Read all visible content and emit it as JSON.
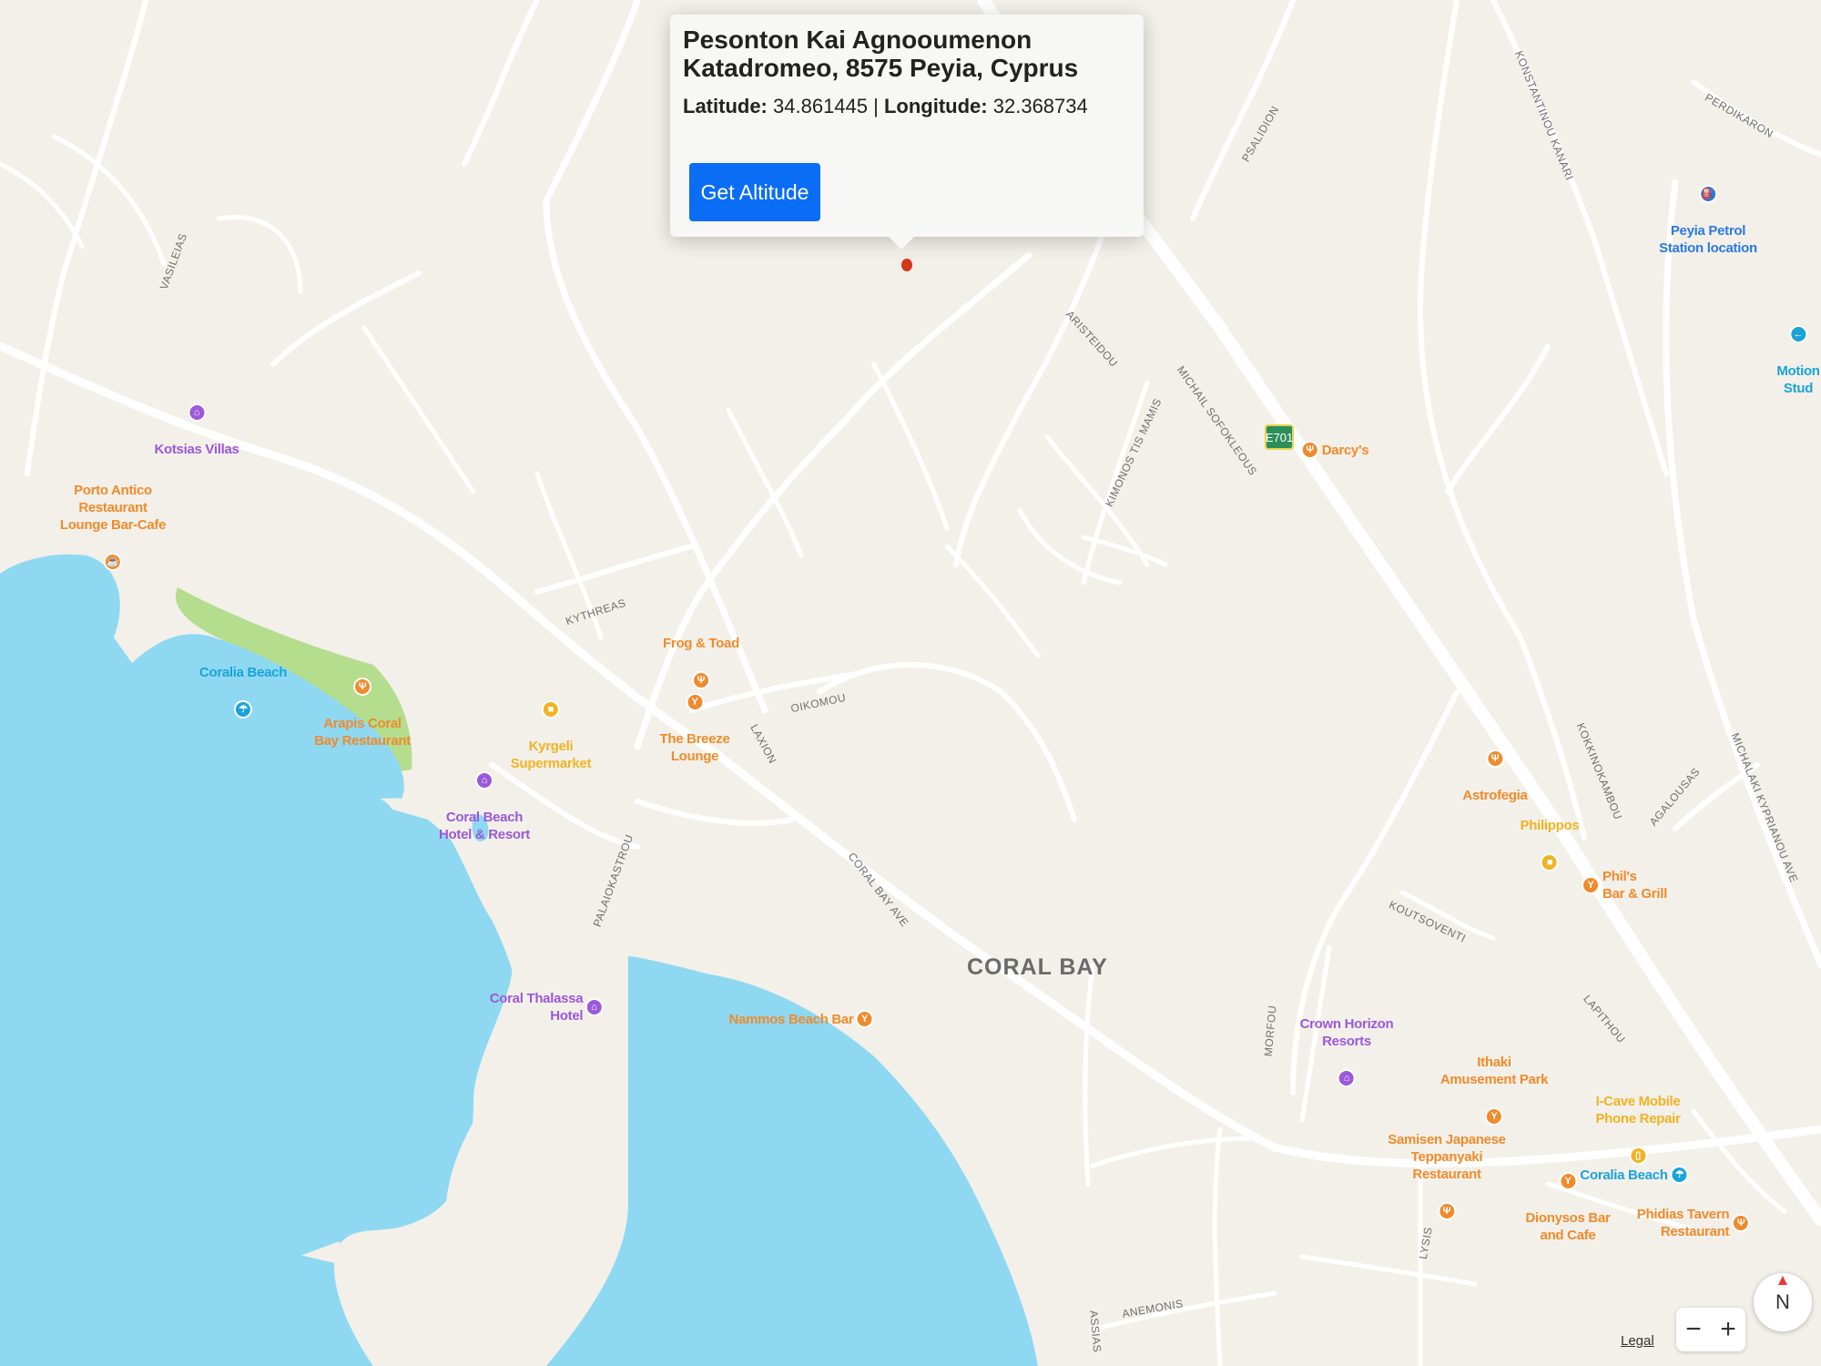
{
  "popup": {
    "title_line1": "Pesonton Kai Agnooumenon",
    "title_line2": "Katadromeo, 8575 Peyia, Cyprus",
    "lat_label": "Latitude:",
    "lat_value": "34.861445",
    "separator": "|",
    "lon_label": "Longitude:",
    "lon_value": "32.368734",
    "button_label": "Get Altitude"
  },
  "area_label": "CORAL BAY",
  "highway_shield": "E701",
  "streets": {
    "vasileias": "VASILEIAS",
    "kythreas": "KYTHREAS",
    "laxion": "LAXION",
    "oikomou": "OIKOMOU",
    "coral_bay_ave": "CORAL BAY AVE",
    "palaiokastrou": "PALAIOKASTROU",
    "psalidion": "PSALIDION",
    "aristeidou": "ARISTEIDOU",
    "michail_sofokleous": "MICHAIL SOFOKLEOUS",
    "kimonos_tis_mamis": "KIMONOS TIS MAMIS",
    "konstantinou_kanari": "KONSTANTINOU KANARI",
    "perdikarou": "PERDIKARON",
    "michalaki_kyprianou_ave": "MICHALAKI KYPRIANOU AVE",
    "agalousas": "AGALOUSAS",
    "kokkinokambou": "KOKKINOKAMBOU",
    "koutsoventi": "KOUTSOVENTI",
    "lapithou": "LAPITHOU",
    "morfou": "MORFOU",
    "lysis": "LYSIS",
    "anemonis": "ANEMONIS",
    "assias": "ASSIAS"
  },
  "pois": [
    {
      "name": "Kotsias Villas",
      "color": "#9b59d9",
      "icon": "bed-icon"
    },
    {
      "name": "Porto Antico\nRestaurant\nLounge Bar-Cafe",
      "color": "#f08b2c",
      "icon": "cafe-icon"
    },
    {
      "name": "Coralia Beach",
      "color": "#1aa3d9",
      "icon": "beach-icon"
    },
    {
      "name": "Arapis Coral\nBay Restaurant",
      "color": "#f08b2c",
      "icon": "restaurant-icon"
    },
    {
      "name": "Kyrgeli\nSupermarket",
      "color": "#f0b323",
      "icon": "shop-icon"
    },
    {
      "name": "Frog & Toad",
      "color": "#f08b2c",
      "icon": "restaurant-icon"
    },
    {
      "name": "The Breeze\nLounge",
      "color": "#f08b2c",
      "icon": "bar-icon"
    },
    {
      "name": "Coral Beach\nHotel & Resort",
      "color": "#9b59d9",
      "icon": "bed-icon"
    },
    {
      "name": "Coral Thalassa\nHotel",
      "color": "#9b59d9",
      "icon": "bed-icon"
    },
    {
      "name": "Nammos Beach Bar",
      "color": "#f08b2c",
      "icon": "bar-icon"
    },
    {
      "name": "Darcy's",
      "color": "#f08b2c",
      "icon": "restaurant-icon"
    },
    {
      "name": "Peyia Petrol\nStation location",
      "color": "#2a7ae2",
      "icon": "fuel-icon"
    },
    {
      "name": "Motion\nStud",
      "color": "#1aa3d9",
      "icon": "arrow-icon"
    },
    {
      "name": "Astrofegia",
      "color": "#f08b2c",
      "icon": "restaurant-icon"
    },
    {
      "name": "Philippos",
      "color": "#f0b323",
      "icon": "shop-icon"
    },
    {
      "name": "Phil's\nBar & Grill",
      "color": "#f08b2c",
      "icon": "bar-icon"
    },
    {
      "name": "Crown Horizon\nResorts",
      "color": "#9b59d9",
      "icon": "bed-icon"
    },
    {
      "name": "Ithaki\nAmusement Park",
      "color": "#f08b2c",
      "icon": "park-icon"
    },
    {
      "name": "I-Cave Mobile\nPhone Repair",
      "color": "#f0b323",
      "icon": "phone-icon"
    },
    {
      "name": "Samisen Japanese\nTeppanyaki\nRestaurant",
      "color": "#f08b2c",
      "icon": "restaurant-icon"
    },
    {
      "name": "Coralia Beach",
      "color": "#1aa3d9",
      "icon": "beach-icon"
    },
    {
      "name": "Dionysos Bar\nand Cafe",
      "color": "#f08b2c",
      "icon": "bar-icon"
    },
    {
      "name": "Phidias Tavern\nRestaurant",
      "color": "#f08b2c",
      "icon": "restaurant-icon"
    }
  ],
  "controls": {
    "zoom_out": "−",
    "zoom_in": "+",
    "compass": "N",
    "legal": "Legal"
  },
  "colors": {
    "land": "#f3f0e9",
    "water": "#8ed8f2",
    "park": "#b4dd8e",
    "button": "#0a6df5",
    "marker": "#d3381c"
  }
}
